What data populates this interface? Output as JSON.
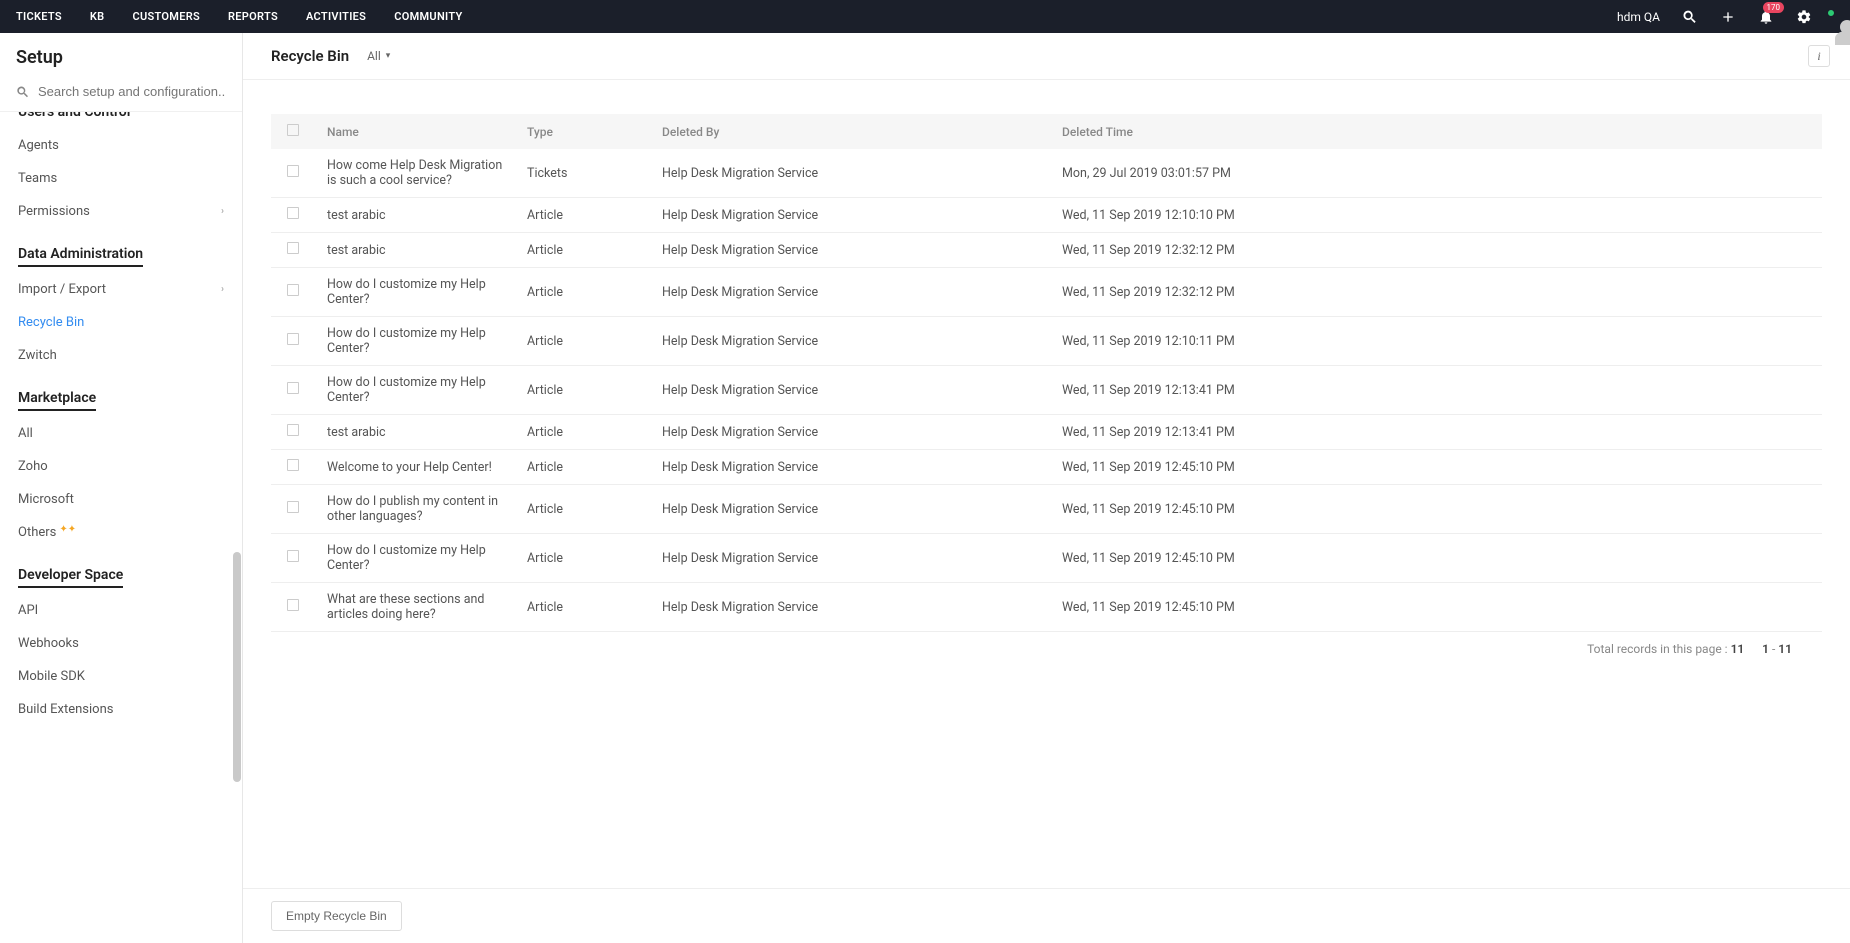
{
  "topnav": {
    "items": [
      "TICKETS",
      "KB",
      "CUSTOMERS",
      "REPORTS",
      "ACTIVITIES",
      "COMMUNITY"
    ],
    "username": "hdm QA",
    "notif_count": "170"
  },
  "sidebar": {
    "title": "Setup",
    "search_placeholder": "Search setup and configuration...",
    "sections": [
      {
        "title": "Users and Control",
        "clipped_top": true,
        "items": [
          {
            "label": "Agents"
          },
          {
            "label": "Teams"
          },
          {
            "label": "Permissions",
            "has_children": true
          }
        ]
      },
      {
        "title": "Data Administration",
        "items": [
          {
            "label": "Import / Export",
            "has_children": true
          },
          {
            "label": "Recycle Bin",
            "active": true
          },
          {
            "label": "Zwitch"
          }
        ]
      },
      {
        "title": "Marketplace",
        "items": [
          {
            "label": "All"
          },
          {
            "label": "Zoho"
          },
          {
            "label": "Microsoft"
          },
          {
            "label": "Others",
            "badge": "sparkle"
          }
        ]
      },
      {
        "title": "Developer Space",
        "items": [
          {
            "label": "API"
          },
          {
            "label": "Webhooks"
          },
          {
            "label": "Mobile SDK"
          },
          {
            "label": "Build Extensions"
          }
        ]
      }
    ]
  },
  "main": {
    "title": "Recycle Bin",
    "filter_label": "All",
    "table": {
      "headers": [
        "Name",
        "Type",
        "Deleted By",
        "Deleted Time"
      ],
      "rows": [
        {
          "name": "How come Help Desk Migration is such a cool service?",
          "type": "Tickets",
          "deleted_by": "Help Desk Migration Service",
          "deleted_time": "Mon, 29 Jul 2019 03:01:57 PM"
        },
        {
          "name": "test arabic",
          "type": "Article",
          "deleted_by": "Help Desk Migration Service",
          "deleted_time": "Wed, 11 Sep 2019 12:10:10 PM"
        },
        {
          "name": "test arabic",
          "type": "Article",
          "deleted_by": "Help Desk Migration Service",
          "deleted_time": "Wed, 11 Sep 2019 12:32:12 PM"
        },
        {
          "name": "How do I customize my Help Center?",
          "type": "Article",
          "deleted_by": "Help Desk Migration Service",
          "deleted_time": "Wed, 11 Sep 2019 12:32:12 PM"
        },
        {
          "name": "How do I customize my Help Center?",
          "type": "Article",
          "deleted_by": "Help Desk Migration Service",
          "deleted_time": "Wed, 11 Sep 2019 12:10:11 PM"
        },
        {
          "name": "How do I customize my Help Center?",
          "type": "Article",
          "deleted_by": "Help Desk Migration Service",
          "deleted_time": "Wed, 11 Sep 2019 12:13:41 PM"
        },
        {
          "name": "test arabic",
          "type": "Article",
          "deleted_by": "Help Desk Migration Service",
          "deleted_time": "Wed, 11 Sep 2019 12:13:41 PM"
        },
        {
          "name": "Welcome to your Help Center!",
          "type": "Article",
          "deleted_by": "Help Desk Migration Service",
          "deleted_time": "Wed, 11 Sep 2019 12:45:10 PM"
        },
        {
          "name": "How do I publish my content in other languages?",
          "type": "Article",
          "deleted_by": "Help Desk Migration Service",
          "deleted_time": "Wed, 11 Sep 2019 12:45:10 PM"
        },
        {
          "name": "How do I customize my Help Center?",
          "type": "Article",
          "deleted_by": "Help Desk Migration Service",
          "deleted_time": "Wed, 11 Sep 2019 12:45:10 PM"
        },
        {
          "name": "What are these sections and articles doing here?",
          "type": "Article",
          "deleted_by": "Help Desk Migration Service",
          "deleted_time": "Wed, 11 Sep 2019 12:45:10 PM"
        }
      ]
    },
    "pagination": {
      "label": "Total records in this page :",
      "count": "11",
      "from": "1",
      "to": "11"
    },
    "empty_btn": "Empty Recycle Bin"
  }
}
